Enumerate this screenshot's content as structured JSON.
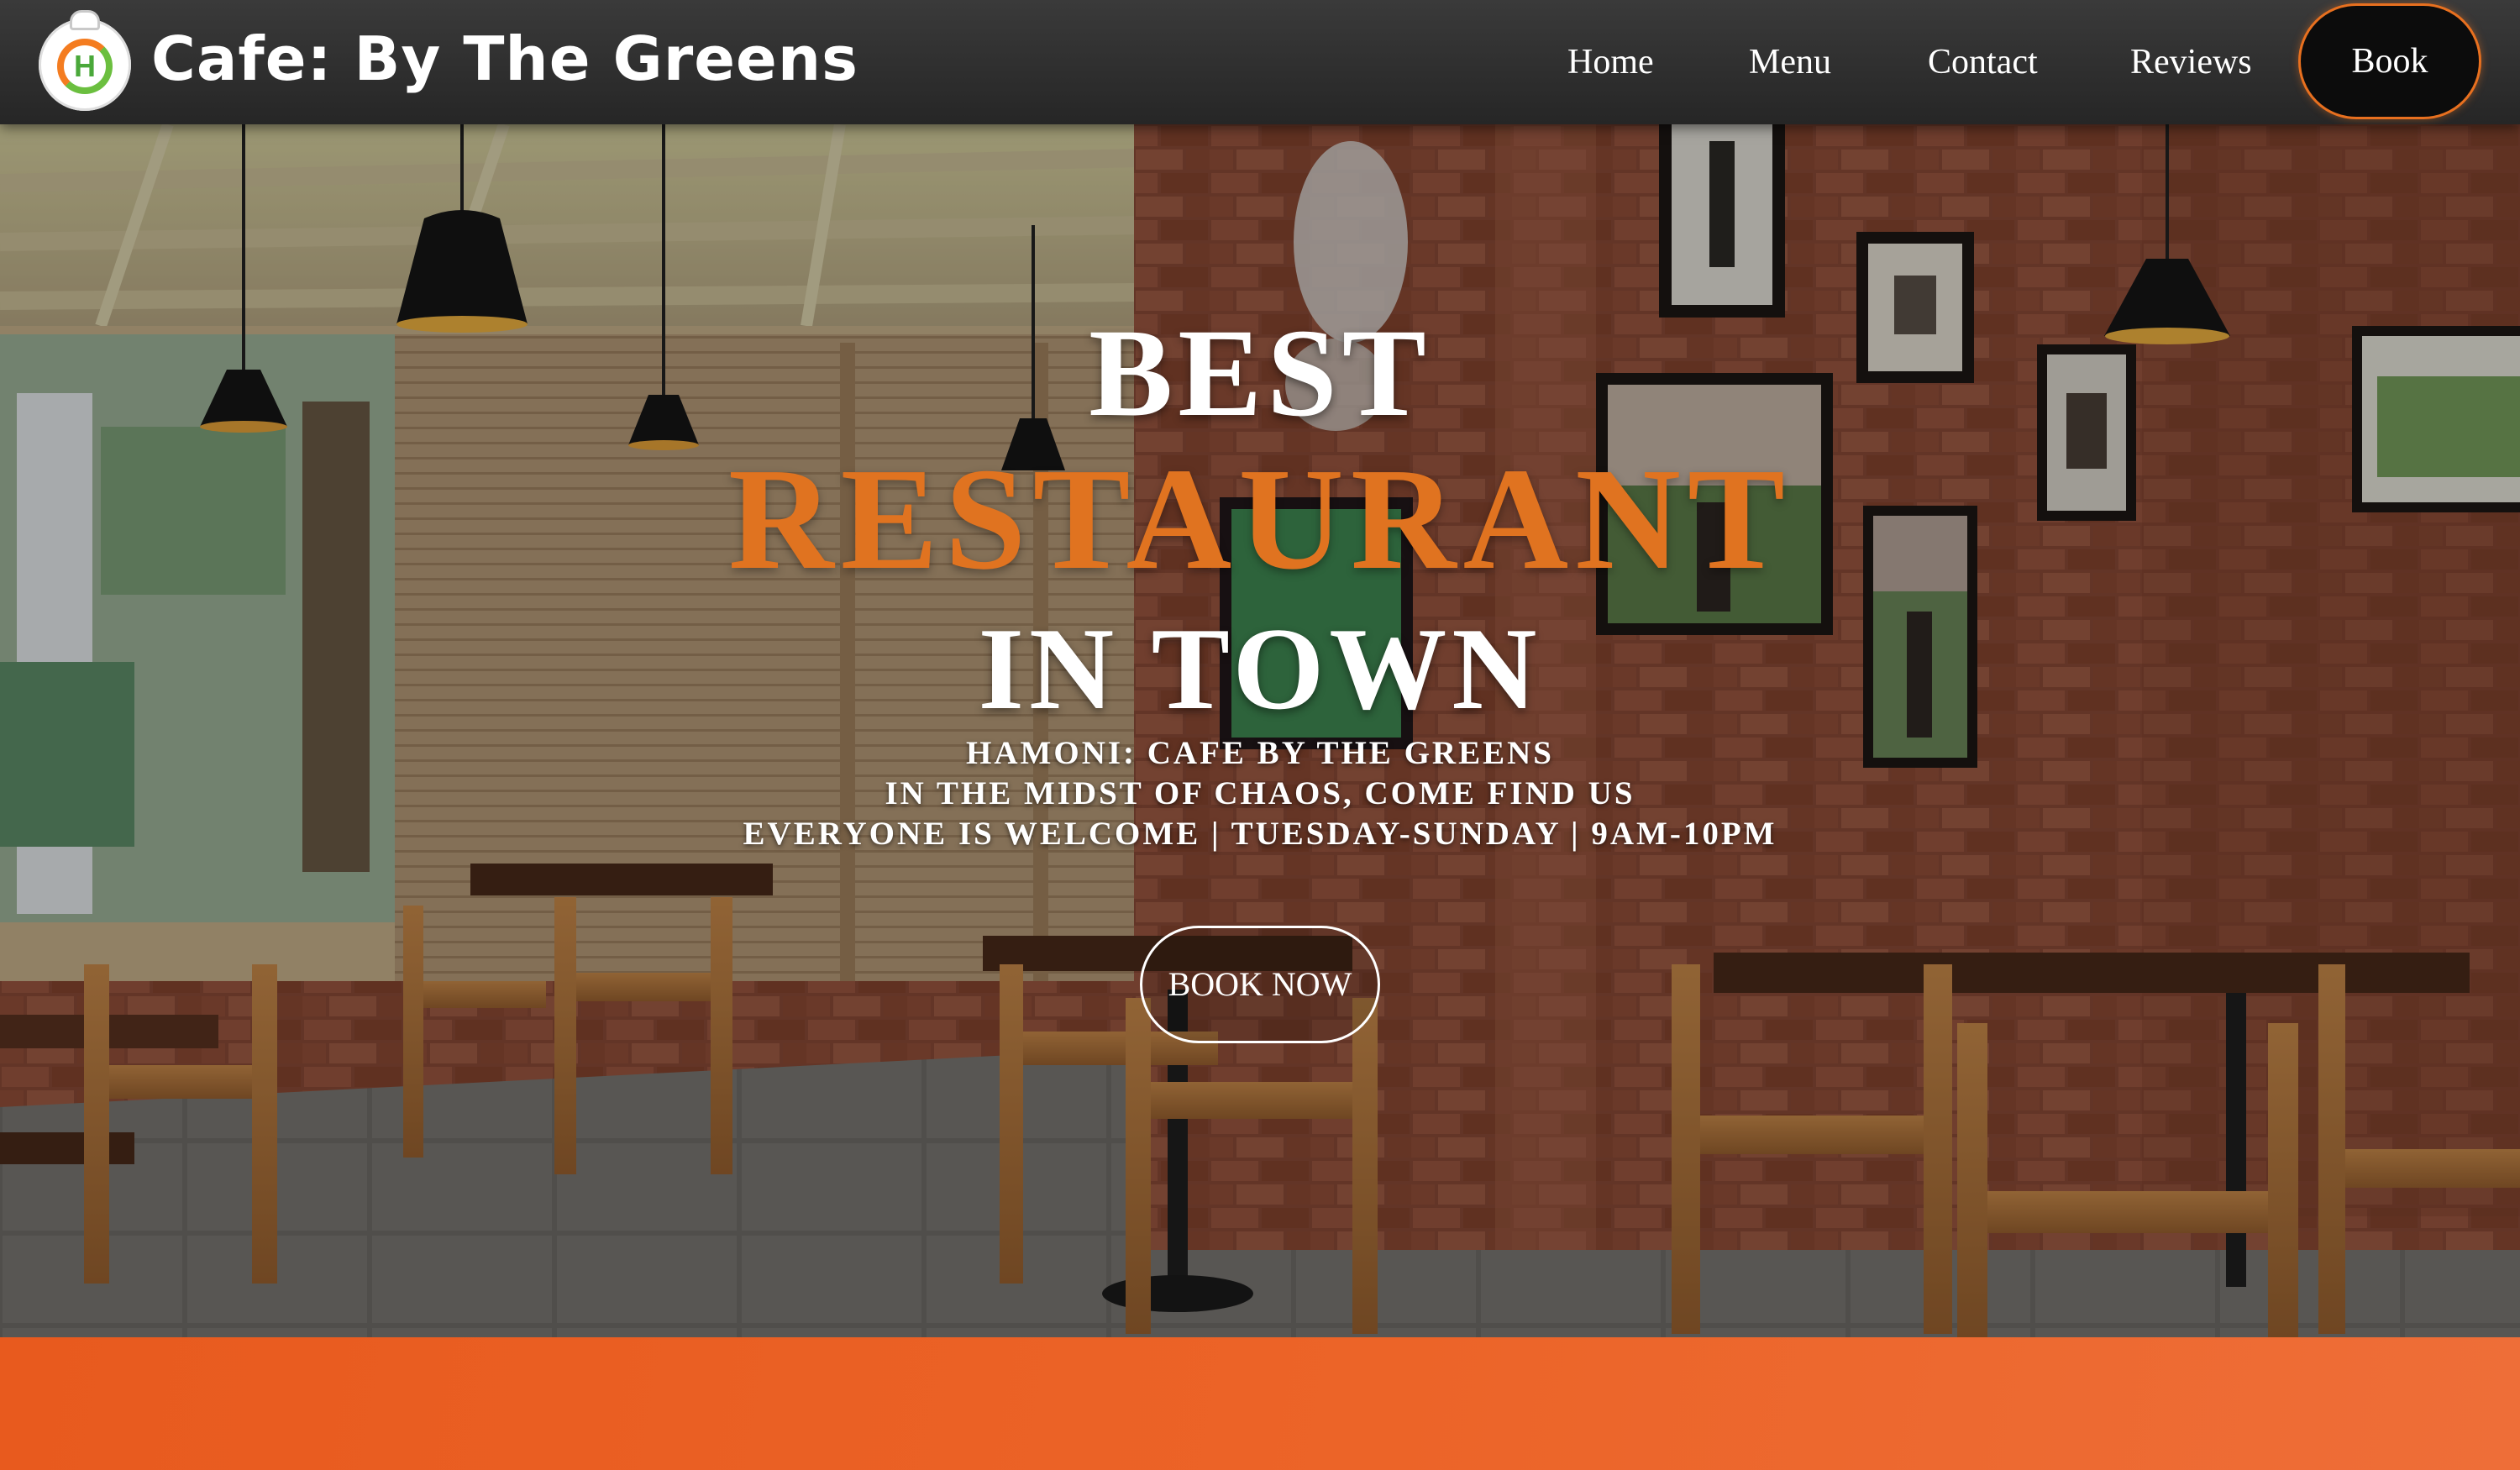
{
  "navbar": {
    "logo_letter": "H",
    "site_title": "Cafe: By The Greens",
    "links": [
      {
        "label": "Home"
      },
      {
        "label": "Menu"
      },
      {
        "label": "Contact"
      },
      {
        "label": "Reviews"
      }
    ],
    "book_label": "Book"
  },
  "hero": {
    "line1": "BEST",
    "line2": "RESTAURANT",
    "line3": "IN TOWN",
    "subtitle1": "HAMONI: CAFE BY THE GREENS",
    "subtitle2": "IN THE MIDST OF CHAOS, COME FIND US",
    "subtitle3": "EVERYONE IS WELCOME | TUESDAY-SUNDAY | 9AM-10PM",
    "cta_label": "BOOK NOW",
    "background_description_icon": "restaurant-interior-photo"
  },
  "colors": {
    "accent_orange": "#e07320",
    "navbar_bg": "#2e2e2e",
    "band_orange": "#ec6428",
    "text_white": "#ffffff"
  }
}
